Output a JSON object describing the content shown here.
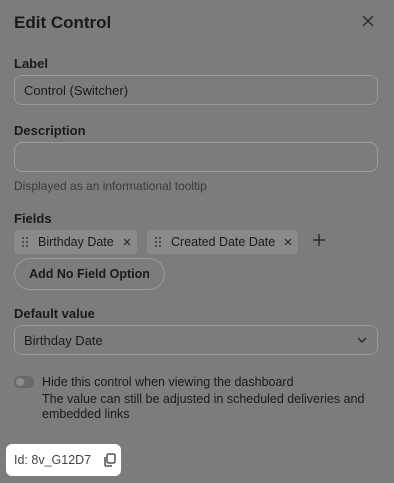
{
  "dialog": {
    "title": "Edit Control"
  },
  "label_field": {
    "label": "Label",
    "value": "Control (Switcher)"
  },
  "description_field": {
    "label": "Description",
    "value": "",
    "hint": "Displayed as an informational tooltip"
  },
  "fields": {
    "label": "Fields",
    "tags": [
      "Birthday Date",
      "Created Date Date"
    ],
    "add_no_field_button": "Add No Field Option"
  },
  "default_value": {
    "label": "Default value",
    "selected": "Birthday Date"
  },
  "hide_control": {
    "label": "Hide this control when viewing the dashboard",
    "sublabel": "The value can still be adjusted in scheduled deliveries and embedded links",
    "enabled": false
  },
  "id_badge": {
    "text": "Id: 8v_G12D7"
  },
  "icons": [
    "close-icon",
    "grip-icon",
    "remove-icon",
    "plus-icon",
    "chevron-down-icon",
    "copy-icon"
  ]
}
